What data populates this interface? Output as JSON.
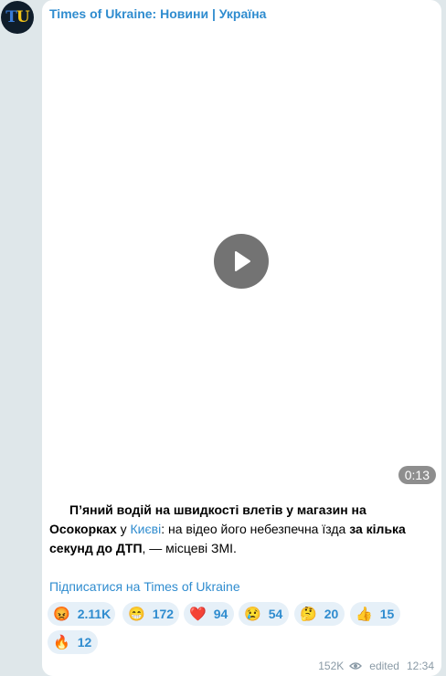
{
  "channel": {
    "name": "Times of Ukraine: Новини | Україна",
    "avatar_text_t": "T",
    "avatar_text_u": "U"
  },
  "video": {
    "duration": "0:13"
  },
  "post": {
    "headline": "П’яний водій на швидкості влетів у магазин на Осокорках",
    "after_headline": " у ",
    "link": "Києві",
    "middle": ": на відео його небезпечна їзда ",
    "bold2": "за кілька секунд до ДТП",
    "tail": ", — місцеві ЗМІ."
  },
  "subscribe_link": "Підписатися на Times of Ukraine",
  "reactions": [
    {
      "emoji": "😡",
      "count": "2.11K"
    },
    {
      "emoji": "😁",
      "count": "172"
    },
    {
      "emoji": "❤️",
      "count": "94"
    },
    {
      "emoji": "😢",
      "count": "54"
    },
    {
      "emoji": "🤔",
      "count": "20"
    },
    {
      "emoji": "👍",
      "count": "15"
    },
    {
      "emoji": "🔥",
      "count": "12"
    }
  ],
  "meta": {
    "views": "152K",
    "edited": "edited",
    "time": "12:34"
  },
  "colors": {
    "accent": "#2f8ccf",
    "reaction_bg": "#e6f0f8",
    "background": "#dfe7ea"
  }
}
